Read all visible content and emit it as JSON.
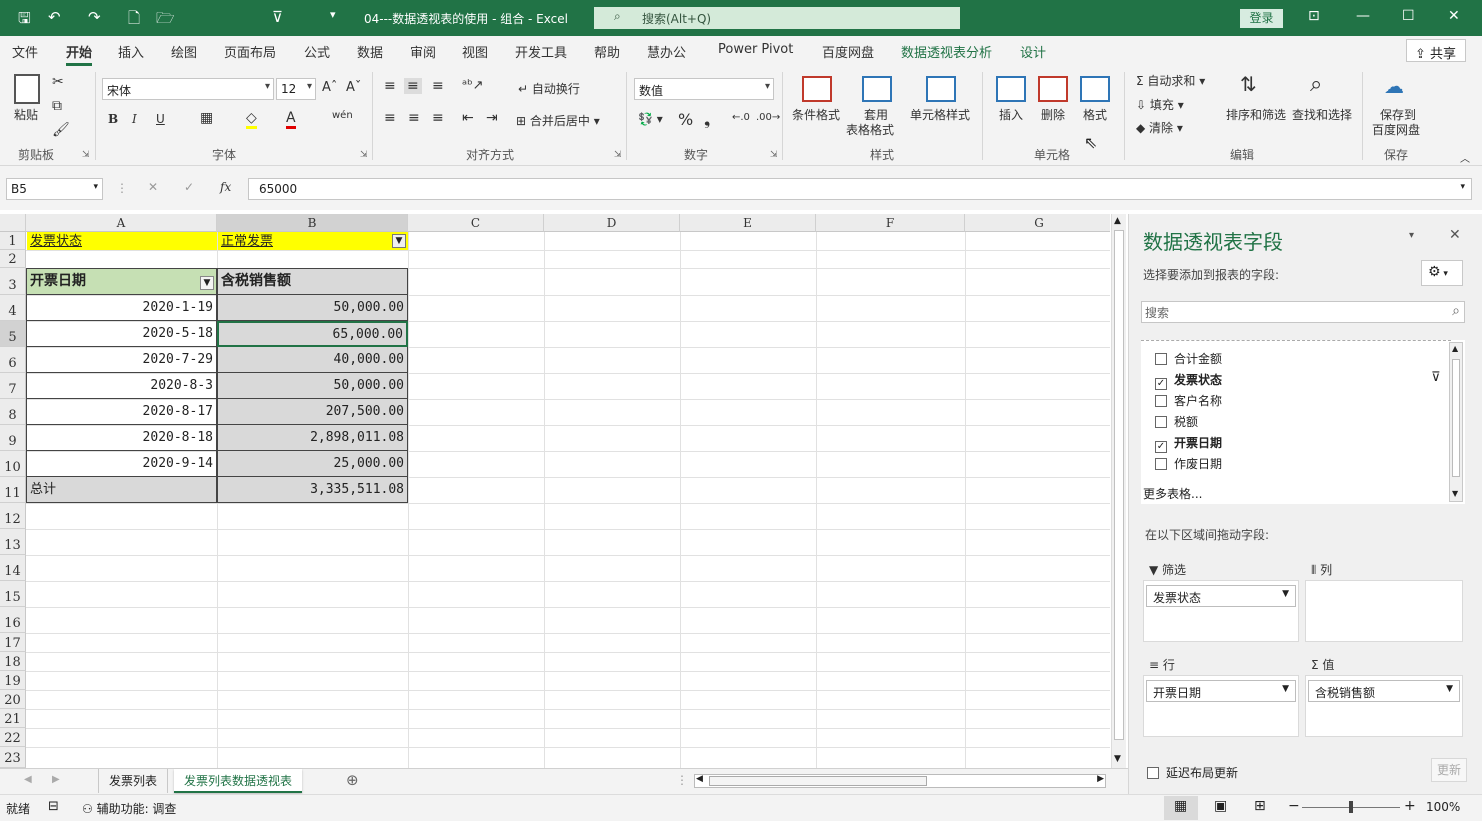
{
  "titlebar": {
    "doc_title": "04---数据透视表的使用 - 组合  -  Excel",
    "search_placeholder": "搜索(Alt+Q)",
    "login": "登录"
  },
  "tabs": [
    "文件",
    "开始",
    "插入",
    "绘图",
    "页面布局",
    "公式",
    "数据",
    "审阅",
    "视图",
    "开发工具",
    "帮助",
    "慧办公",
    "Power Pivot",
    "百度网盘",
    "数据透视表分析",
    "设计"
  ],
  "share": "共享",
  "ribbon": {
    "clipboard": {
      "paste": "粘贴",
      "label": "剪贴板"
    },
    "font": {
      "name": "宋体",
      "size": "12",
      "label": "字体",
      "bold": "B",
      "italic": "I",
      "underline": "U",
      "font_color_letter": "A"
    },
    "alignment": {
      "wrap": "自动换行",
      "merge": "合并后居中",
      "label": "对齐方式"
    },
    "number": {
      "format": "数值",
      "percent": "%",
      "label": "数字"
    },
    "styles": {
      "conditional": "条件格式",
      "table_fmt1": "套用",
      "table_fmt2": "表格格式",
      "cell_styles": "单元格样式",
      "label": "样式"
    },
    "cells": {
      "insert": "插入",
      "delete": "删除",
      "format": "格式",
      "label": "单元格"
    },
    "editing": {
      "autosum": "自动求和",
      "fill": "填充",
      "clear": "清除",
      "sort_filter": "排序和筛选",
      "find_select": "查找和选择",
      "label": "编辑"
    },
    "save": {
      "save_to1": "保存到",
      "save_to2": "百度网盘",
      "label": "保存"
    }
  },
  "formula_bar": {
    "name_box": "B5",
    "content": "65000",
    "fx": "fx"
  },
  "columns": [
    "A",
    "B",
    "C",
    "D",
    "E",
    "F",
    "G"
  ],
  "row_numbers": [
    "1",
    "2",
    "3",
    "4",
    "5",
    "6",
    "7",
    "8",
    "9",
    "10",
    "11",
    "12",
    "13",
    "14",
    "15",
    "16",
    "17",
    "18",
    "19",
    "20",
    "21",
    "22",
    "23"
  ],
  "sheet": {
    "r1": {
      "a": "发票状态",
      "b": "正常发票"
    },
    "r3": {
      "a": "开票日期",
      "b": "含税销售额"
    },
    "rows": [
      {
        "date": "2020-1-19",
        "amount": "50,000.00"
      },
      {
        "date": "2020-5-18",
        "amount": "65,000.00"
      },
      {
        "date": "2020-7-29",
        "amount": "40,000.00"
      },
      {
        "date": "2020-8-3",
        "amount": "50,000.00"
      },
      {
        "date": "2020-8-17",
        "amount": "207,500.00"
      },
      {
        "date": "2020-8-18",
        "amount": "2,898,011.08"
      },
      {
        "date": "2020-9-14",
        "amount": "25,000.00"
      }
    ],
    "total": {
      "label": "总计",
      "amount": "3,335,511.08"
    }
  },
  "sheet_tabs": [
    "发票列表",
    "发票列表数据透视表"
  ],
  "pivot_pane": {
    "title": "数据透视表字段",
    "subtitle": "选择要添加到报表的字段:",
    "search_placeholder": "搜索",
    "fields": [
      {
        "name": "合计金额",
        "checked": false
      },
      {
        "name": "发票状态",
        "checked": true
      },
      {
        "name": "客户名称",
        "checked": false
      },
      {
        "name": "税额",
        "checked": false
      },
      {
        "name": "开票日期",
        "checked": true
      },
      {
        "name": "作废日期",
        "checked": false
      }
    ],
    "more_tables": "更多表格...",
    "drag_hint": "在以下区域间拖动字段:",
    "filters_label": "筛选",
    "columns_label": "列",
    "rows_label": "行",
    "values_label": "值",
    "filter_item": "发票状态",
    "row_item": "开票日期",
    "value_item": "含税销售额",
    "defer_update": "延迟布局更新",
    "update_btn": "更新"
  },
  "statusbar": {
    "ready": "就绪",
    "accessibility": "辅助功能: 调查",
    "zoom": "100%"
  }
}
